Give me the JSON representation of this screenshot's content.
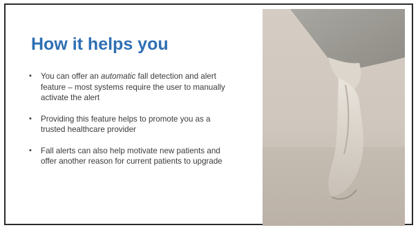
{
  "slide": {
    "title": "How it helps you",
    "bullets": [
      {
        "before": "You can offer an ",
        "emphasis": "automatic",
        "after": " fall detection and alert feature – most systems require the user to manually activate the alert"
      },
      {
        "before": "Providing this feature helps to promote you as a trusted healthcare provider",
        "emphasis": "",
        "after": ""
      },
      {
        "before": "Fall alerts can also help motivate new patients and offer another reason for current patients to upgrade",
        "emphasis": "",
        "after": ""
      }
    ],
    "bullet_glyph": "•"
  },
  "colors": {
    "title": "#2f6fb3",
    "text": "#3a3a3a",
    "border": "#2b2b2b"
  }
}
